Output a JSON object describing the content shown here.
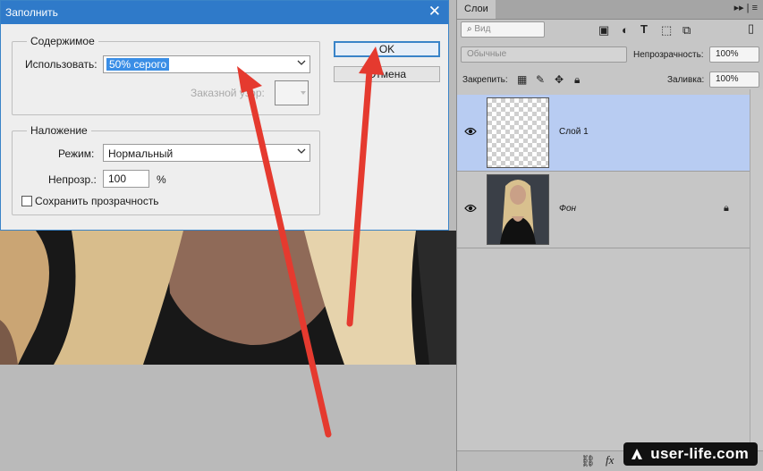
{
  "dialog": {
    "title": "Заполнить",
    "close_glyph": "✕",
    "content_group": {
      "legend": "Содержимое",
      "use_label": "Использовать:",
      "use_value": "50% серого",
      "custom_pattern_label": "Заказной узор:"
    },
    "blend_group": {
      "legend": "Наложение",
      "mode_label": "Режим:",
      "mode_value": "Нормальный",
      "opacity_label": "Непрозр.:",
      "opacity_value": "100",
      "opacity_unit": "%",
      "preserve_label": "Сохранить прозрачность",
      "preserve_checked": false
    },
    "buttons": {
      "ok": "OK",
      "cancel": "Отмена"
    }
  },
  "layers_panel": {
    "tab": "Слои",
    "menu_glyphs": "▸▸ | ≡",
    "filter_value": "Вид",
    "blend_value": "Обычные",
    "opacity_label": "Непрозрачность:",
    "opacity_value": "100%",
    "lock_label": "Закрепить:",
    "fill_label": "Заливка:",
    "fill_value": "100%",
    "layers": [
      {
        "name": "Слой 1",
        "selected": true,
        "visible": true,
        "thumbnail": "transparent"
      },
      {
        "name": "Фон",
        "selected": false,
        "visible": true,
        "thumbnail": "photo",
        "locked": true
      }
    ],
    "footer_icons": [
      "link-icon",
      "fx-icon"
    ]
  },
  "watermark": {
    "text": "user-life.com"
  },
  "colors": {
    "accent": "#2f7ac9",
    "arrow": "#e53a2f",
    "selected_layer": "#b8ccf2"
  }
}
